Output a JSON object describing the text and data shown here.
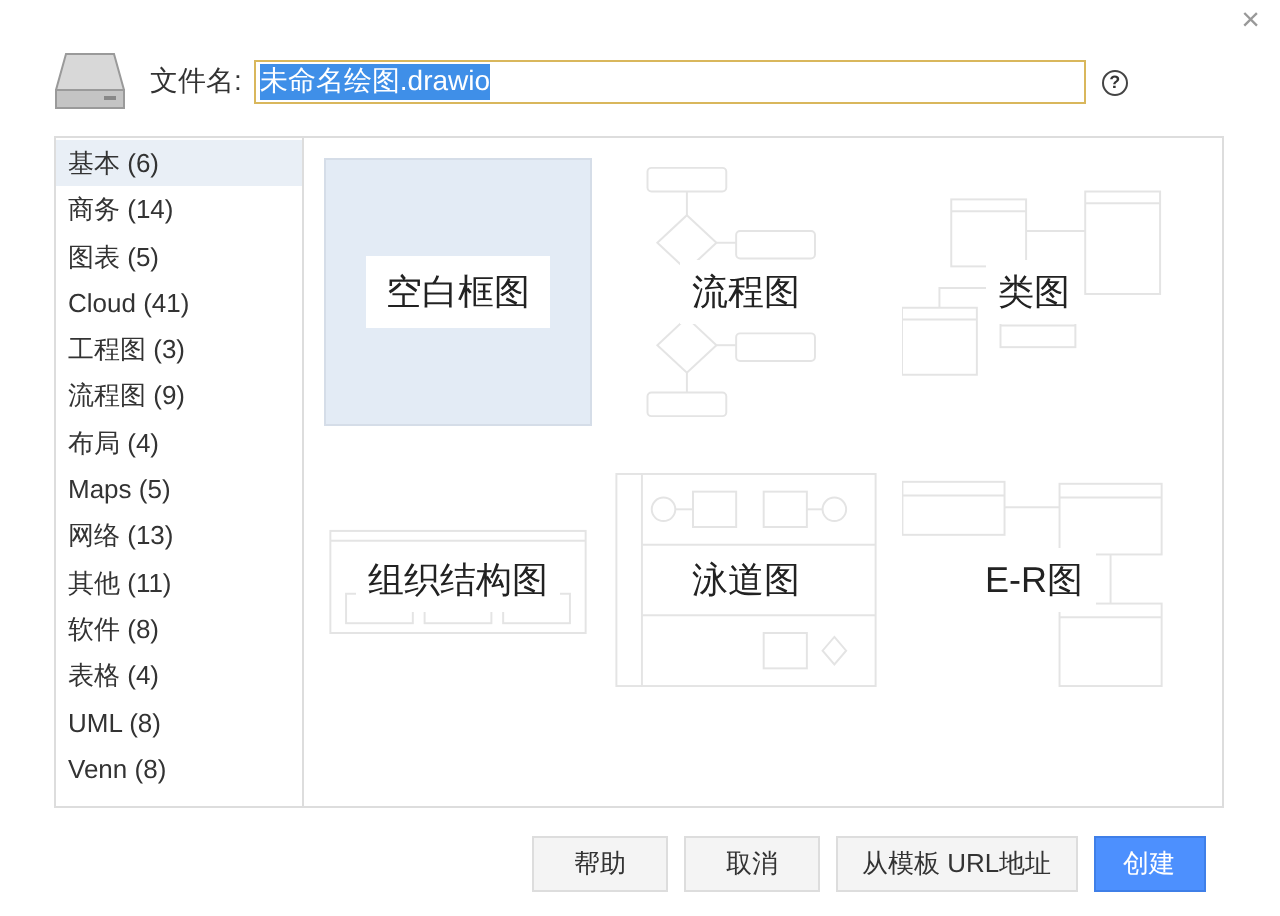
{
  "close": "×",
  "filename": {
    "label": "文件名:",
    "value": "未命名绘图.drawio",
    "help": "?"
  },
  "categories": [
    {
      "label": "基本 (6)",
      "selected": true
    },
    {
      "label": "商务 (14)",
      "selected": false
    },
    {
      "label": "图表 (5)",
      "selected": false
    },
    {
      "label": "Cloud (41)",
      "selected": false
    },
    {
      "label": "工程图 (3)",
      "selected": false
    },
    {
      "label": "流程图 (9)",
      "selected": false
    },
    {
      "label": "布局 (4)",
      "selected": false
    },
    {
      "label": "Maps (5)",
      "selected": false
    },
    {
      "label": "网络 (13)",
      "selected": false
    },
    {
      "label": "其他 (11)",
      "selected": false
    },
    {
      "label": "软件 (8)",
      "selected": false
    },
    {
      "label": "表格 (4)",
      "selected": false
    },
    {
      "label": "UML (8)",
      "selected": false
    },
    {
      "label": "Venn (8)",
      "selected": false
    }
  ],
  "templates": [
    {
      "label": "空白框图",
      "kind": "blank",
      "selected": true
    },
    {
      "label": "流程图",
      "kind": "flowchart",
      "selected": false
    },
    {
      "label": "类图",
      "kind": "class",
      "selected": false
    },
    {
      "label": "组织结构图",
      "kind": "org",
      "selected": false
    },
    {
      "label": "泳道图",
      "kind": "swimlane",
      "selected": false
    },
    {
      "label": "E-R图",
      "kind": "er",
      "selected": false
    }
  ],
  "buttons": [
    {
      "label": "帮助",
      "kind": "plain"
    },
    {
      "label": "取消",
      "kind": "plain"
    },
    {
      "label": "从模板 URL地址",
      "kind": "plain"
    },
    {
      "label": "创建",
      "kind": "primary"
    }
  ]
}
